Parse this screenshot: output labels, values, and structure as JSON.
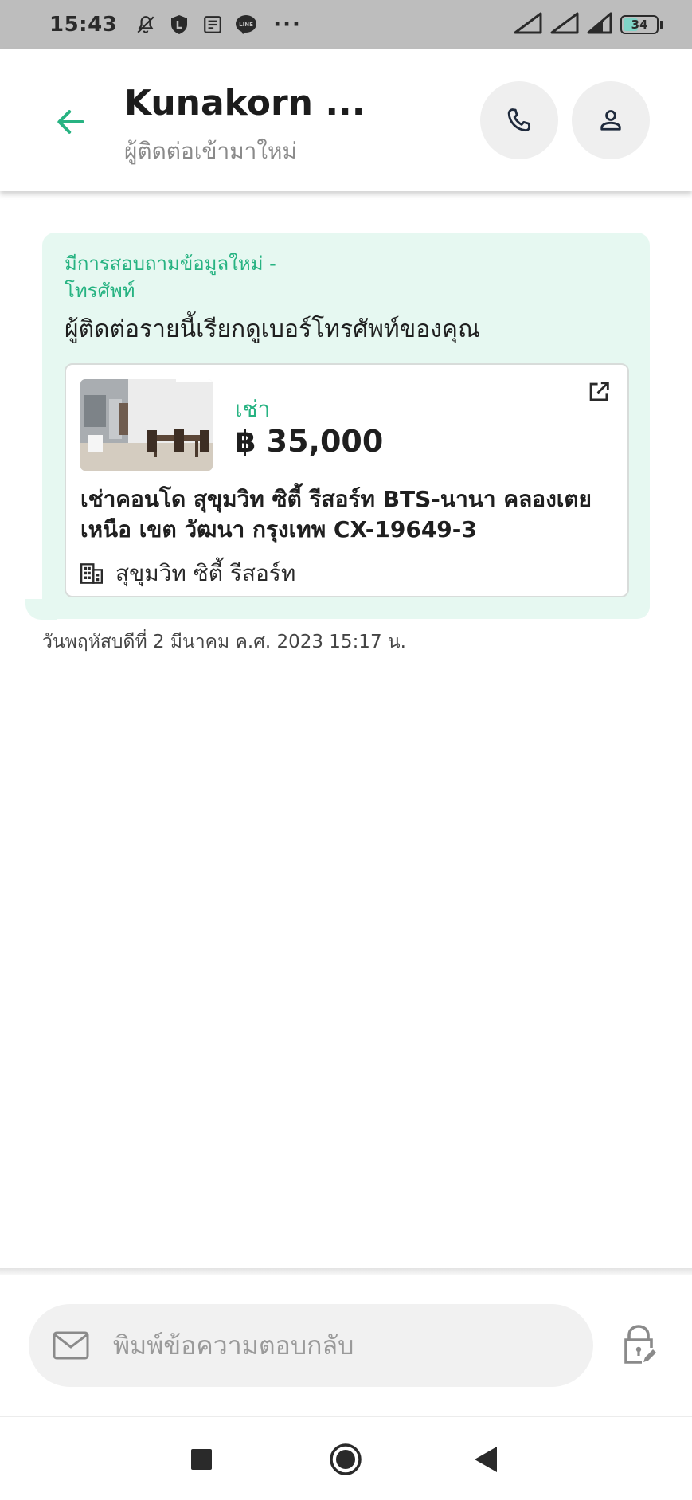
{
  "status_bar": {
    "time": "15:43",
    "battery": "34",
    "more": "···"
  },
  "header": {
    "title": "Kunakorn ...",
    "subtitle": "ผู้ติดต่อเข้ามาใหม่"
  },
  "message": {
    "title": "มีการสอบถามข้อมูลใหม่ - โทรศัพท์",
    "text": "ผู้ติดต่อรายนี้เรียกดูเบอร์โทรศัพท์ของคุณ",
    "timestamp": "วันพฤหัสบดีที่ 2 มีนาคม ค.ศ. 2023 15:17 น."
  },
  "listing": {
    "type": "เช่า",
    "price": "฿ 35,000",
    "title": "เช่าคอนโด  สุขุมวิท ซิตี้ รีสอร์ท BTS-นานา คลองเตยเหนือ เขต วัฒนา กรุงเทพ CX-19649-3",
    "project": "สุขุมวิท ซิตี้ รีสอร์ท"
  },
  "compose": {
    "placeholder": "พิมพ์ข้อความตอบกลับ"
  },
  "colors": {
    "accent": "#27b382",
    "bubble_bg": "#e6f8f1",
    "status_bar": "#bdbdbd"
  }
}
